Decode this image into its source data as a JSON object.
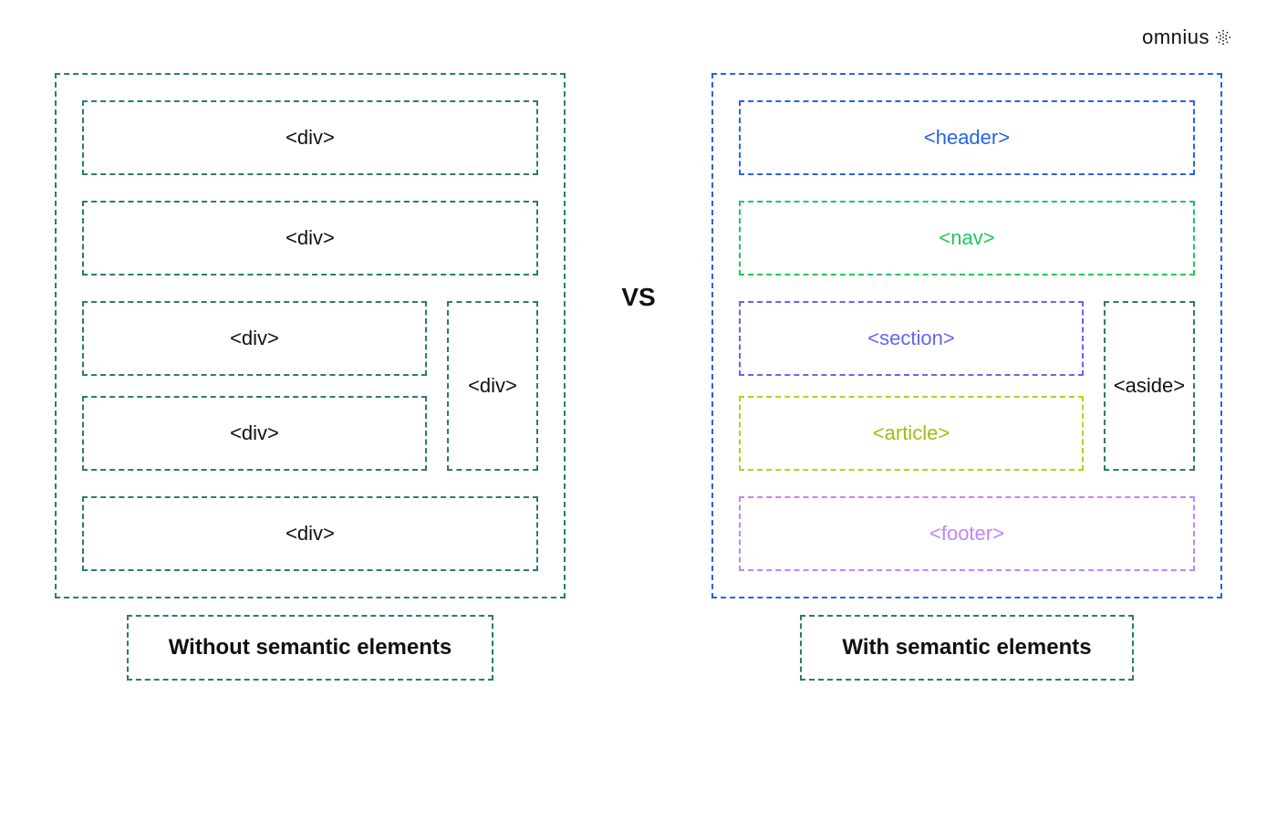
{
  "brand": {
    "name": "omnius"
  },
  "vs_label": "VS",
  "left": {
    "caption": "Without semantic elements",
    "boxes": {
      "b1": "<div>",
      "b2": "<div>",
      "b3": "<div>",
      "b4": "<div>",
      "b5": "<div>",
      "b6": "<div>"
    }
  },
  "right": {
    "caption": "With semantic elements",
    "boxes": {
      "header": "<header>",
      "nav": "<nav>",
      "section": "<section>",
      "article": "<article>",
      "aside": "<aside>",
      "footer": "<footer>"
    }
  },
  "colors": {
    "teal": "#2a7d6f",
    "blue": "#2563eb",
    "green": "#22c55e",
    "indigo": "#6366f1",
    "lime": "#bfcc1a",
    "purple": "#c084fc"
  }
}
